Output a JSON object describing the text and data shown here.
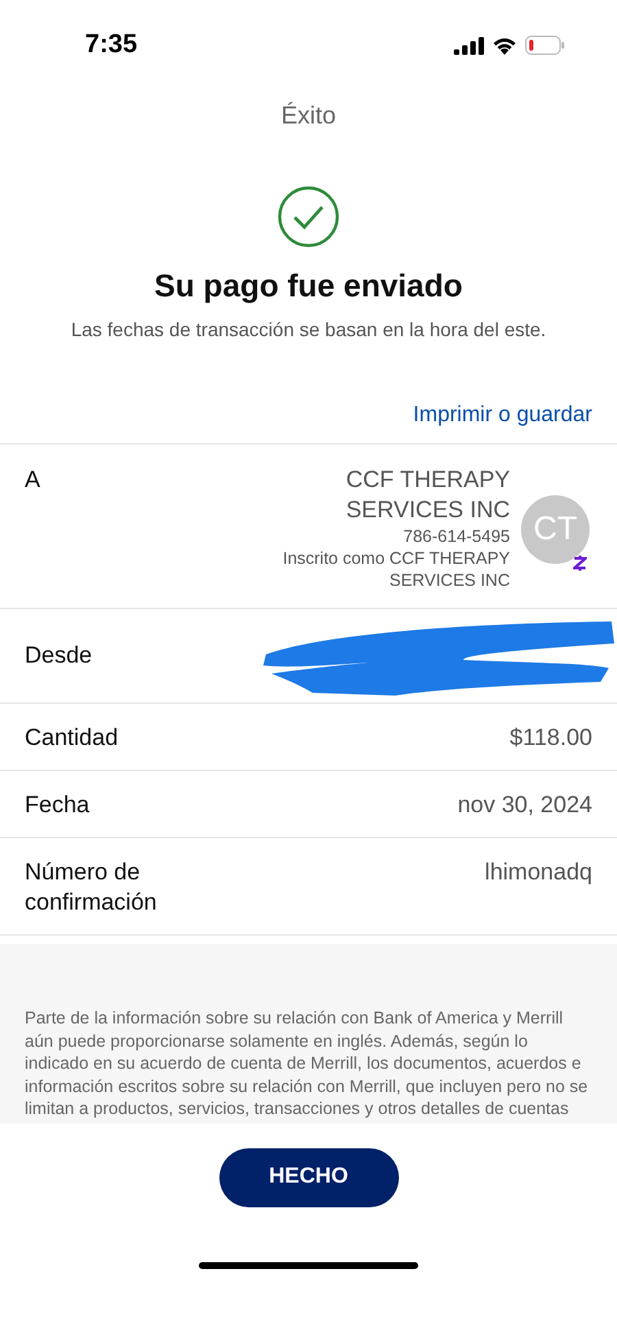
{
  "status_bar": {
    "time": "7:35",
    "battery_low": true
  },
  "header": {
    "title": "Éxito"
  },
  "result": {
    "heading": "Su pago fue enviado",
    "note": "Las fechas de transacción se basan en la hora del este."
  },
  "print_link": "Imprimir o guardar",
  "recipient": {
    "label": "A",
    "name": "CCF THERAPY SERVICES INC",
    "phone": "786-614-5495",
    "enrolled": "Inscrito como CCF THERAPY SERVICES INC",
    "initials": "CT"
  },
  "details": [
    {
      "label": "Desde",
      "kind": "redacted"
    },
    {
      "label": "Cantidad",
      "kind": "text",
      "value": "$118.00"
    },
    {
      "label": "Fecha",
      "kind": "text",
      "value": "nov 30, 2024"
    },
    {
      "label": "Número de confirmación",
      "kind": "text",
      "value": "lhimonadq"
    }
  ],
  "disclaimer": "Parte de la información sobre su relación con Bank of America y Merrill aún puede proporcionarse solamente en inglés. Además, según lo indicado en su acuerdo de cuenta de Merrill, los documentos, acuerdos e información escritos sobre su relación con Merrill, que incluyen pero no se limitan a productos, servicios, transacciones y otros detalles de cuentas",
  "done_button": "HECHO"
}
